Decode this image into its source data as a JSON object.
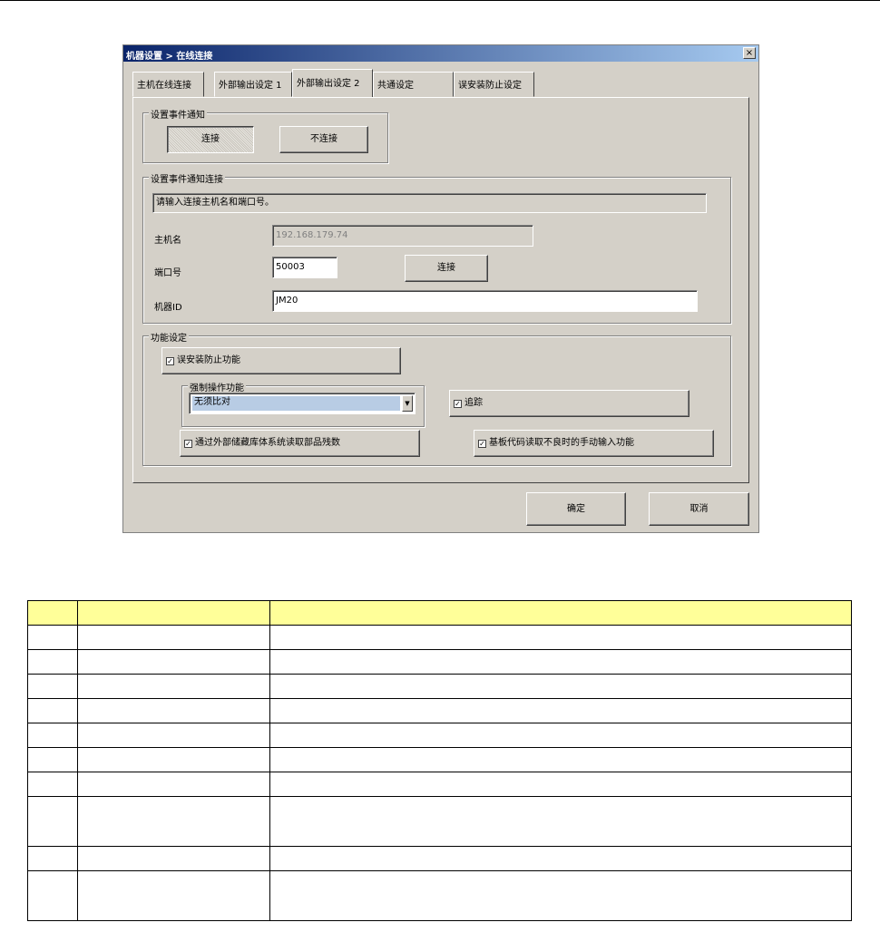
{
  "dialog": {
    "title": "机器设置 > 在线连接",
    "close_label": "×",
    "tabs": [
      {
        "label": "主机在线连接",
        "active": false
      },
      {
        "label": "外部输出设定 1",
        "active": false
      },
      {
        "label": "外部输出设定 2",
        "active": true
      },
      {
        "label": "共通设定",
        "active": false
      },
      {
        "label": "误安装防止设定",
        "active": false
      }
    ],
    "event_notify": {
      "group_label": "设置事件通知",
      "connect_label": "连接",
      "disconnect_label": "不连接",
      "selected": "连接"
    },
    "event_connection": {
      "group_label": "设置事件通知连接",
      "instruction": "请输入连接主机名和端口号。",
      "host_label": "主机名",
      "host_value": "192.168.179.74",
      "port_label": "端口号",
      "port_value": "50003",
      "connect_button": "连接",
      "machine_id_label": "机器ID",
      "machine_id_value": "JM20"
    },
    "functions": {
      "group_label": "功能设定",
      "misinstall_prevent": {
        "label": "误安装防止功能",
        "checked": true
      },
      "forced_operation": {
        "group_label": "强制操作功能",
        "combo_value": "无须比对"
      },
      "tracking": {
        "label": "追踪",
        "checked": true
      },
      "external_storage_read": {
        "label": "通过外部储藏库体系统读取部品残数",
        "checked": true
      },
      "manual_input": {
        "label": "基板代码读取不良时的手动输入功能",
        "checked": true
      }
    },
    "ok_label": "确定",
    "cancel_label": "取消"
  },
  "spec_table": {
    "rows": [
      {
        "height": "normal",
        "cells": [
          "",
          "",
          ""
        ],
        "header": true
      },
      {
        "height": "normal",
        "cells": [
          "",
          "",
          ""
        ]
      },
      {
        "height": "normal",
        "cells": [
          "",
          "",
          ""
        ]
      },
      {
        "height": "normal",
        "cells": [
          "",
          "",
          ""
        ]
      },
      {
        "height": "normal",
        "cells": [
          "",
          "",
          ""
        ]
      },
      {
        "height": "normal",
        "cells": [
          "",
          "",
          ""
        ]
      },
      {
        "height": "normal",
        "cells": [
          "",
          "",
          ""
        ]
      },
      {
        "height": "normal",
        "cells": [
          "",
          "",
          ""
        ]
      },
      {
        "height": "tall",
        "cells": [
          "",
          "",
          ""
        ]
      },
      {
        "height": "normal",
        "cells": [
          "",
          "",
          ""
        ]
      },
      {
        "height": "tall",
        "cells": [
          "",
          "",
          ""
        ]
      }
    ]
  }
}
